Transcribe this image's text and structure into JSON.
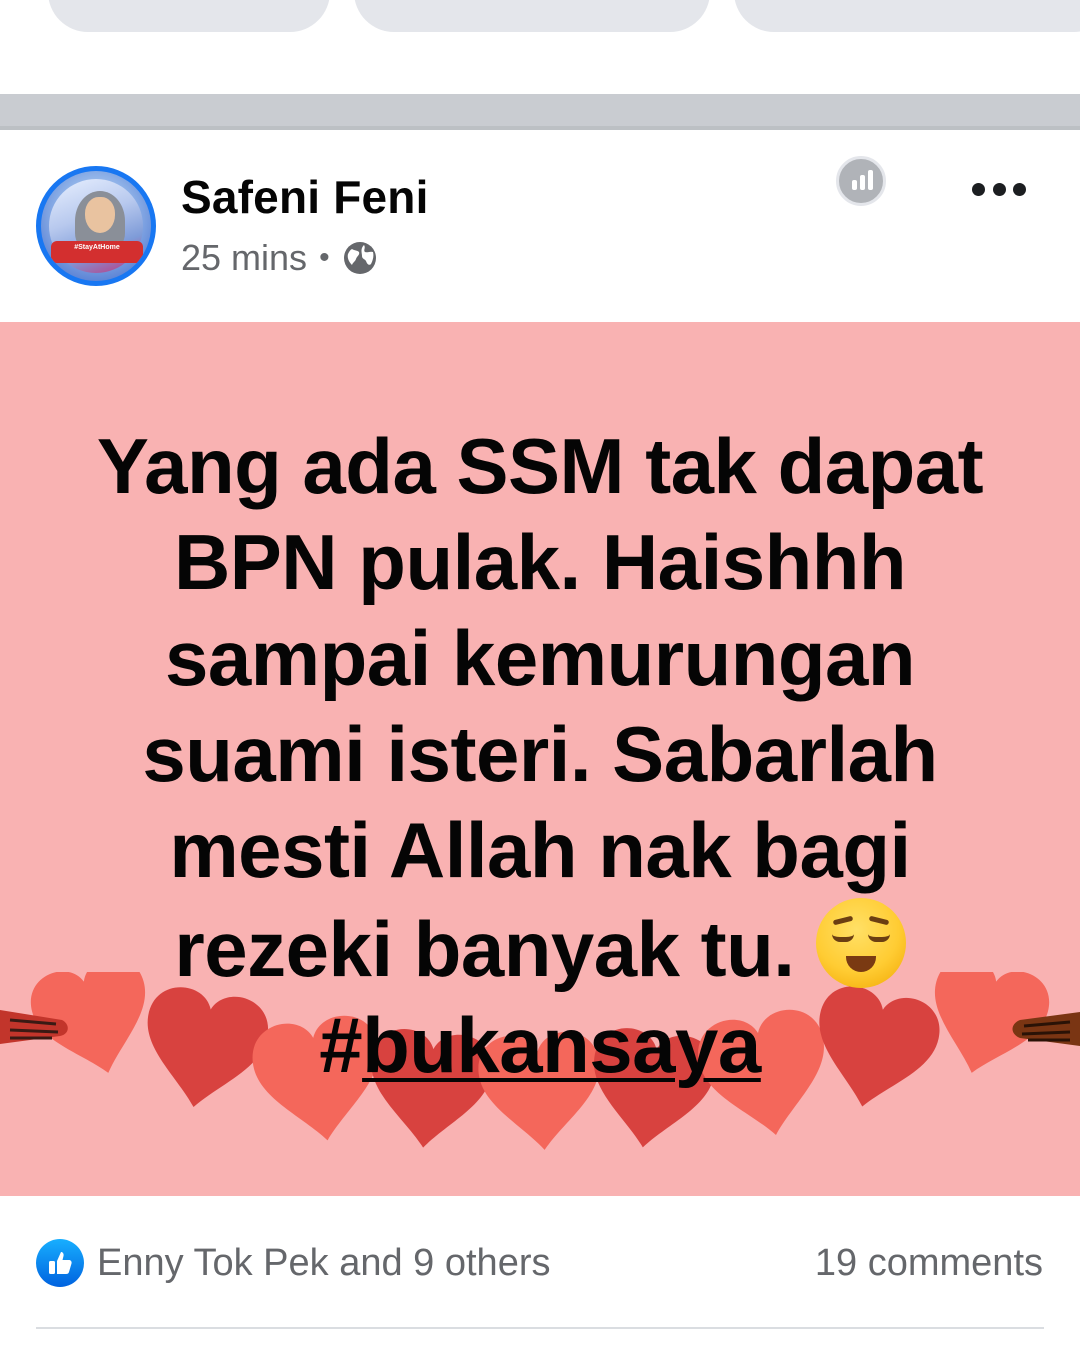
{
  "post": {
    "author": "Safeni Feni",
    "time": "25 mins",
    "separator": "•",
    "audience_icon": "globe-icon",
    "avatar_badge": "#StayAtHome",
    "text_lines": [
      "Yang ada SSM tak dapat",
      "BPN pulak. Haishhh",
      "sampai kemurungan",
      "suami isteri. Sabarlah",
      "mesti Allah nak bagi",
      "rezeki banyak tu."
    ],
    "emoji": "relieved-face-emoji",
    "hashtag_prefix": "#",
    "hashtag": "bukansaya",
    "background_color": "#f9b2b2"
  },
  "engagement": {
    "reaction_icon": "like-icon",
    "likes": "Enny Tok Pek and 9 others",
    "comments": "19 comments"
  },
  "colors": {
    "accent": "#1877f2",
    "secondary_text": "#65676b"
  }
}
